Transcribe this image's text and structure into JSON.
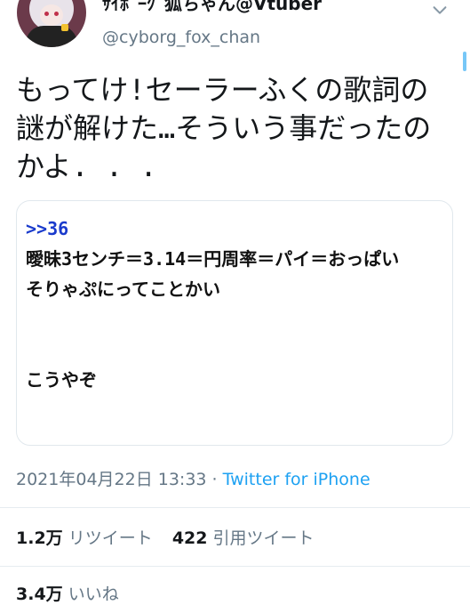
{
  "header": {
    "display_name": "ｻｲﾎﾞｰｸﾞ狐ちゃん@Vtuber",
    "handle": "@cyborg_fox_chan"
  },
  "tweet": {
    "text": "もってけ!セーラーふくの歌詞の\n謎が解けた…そういう事だったの\nかよ. . ."
  },
  "quote": {
    "ref": ">>36",
    "line1": "曖昧3センチ＝3.14＝円周率＝パイ＝おっぱい",
    "line2": "そりゃぷにってことかい",
    "line3": "こうやぞ"
  },
  "meta": {
    "timestamp": "2021年04月22日 13:33",
    "separator": " · ",
    "source": "Twitter for iPhone"
  },
  "stats": {
    "retweets_count": "1.2万",
    "retweets_label": "リツイート",
    "quotes_count": "422",
    "quotes_label": "引用ツイート",
    "likes_count": "3.4万",
    "likes_label": "いいね"
  },
  "icons": {
    "chevron": "chevron-down-icon",
    "accent_color": "#1da1f2"
  }
}
